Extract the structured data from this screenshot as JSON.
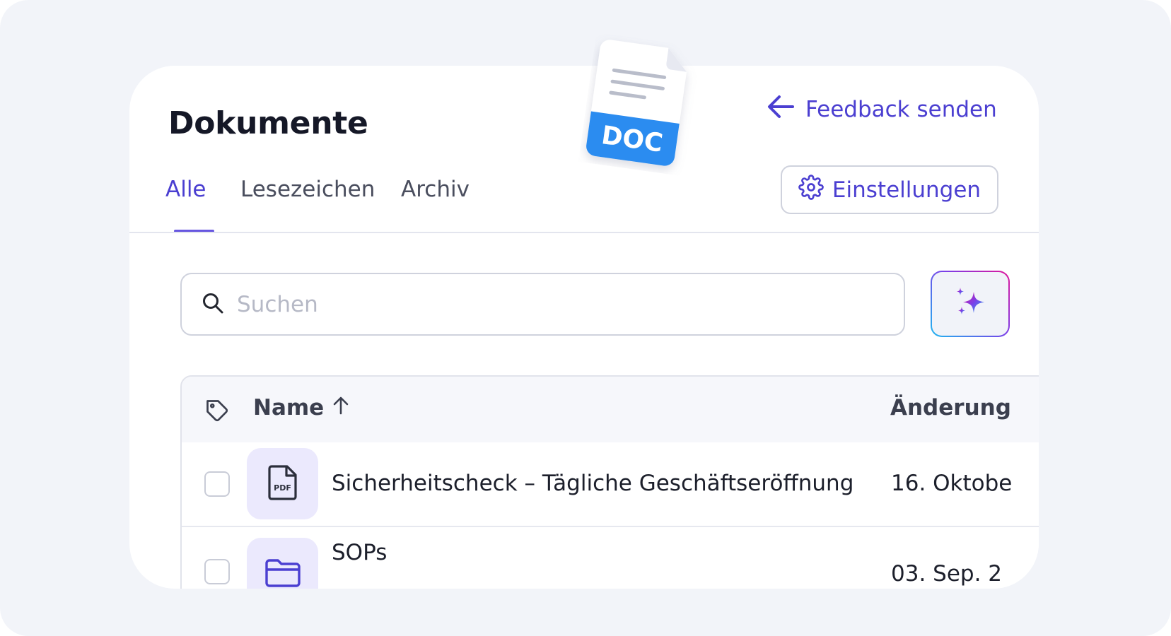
{
  "page": {
    "title": "Dokumente",
    "feedback_label": "Feedback senden",
    "settings_label": "Einstellungen"
  },
  "tabs": [
    {
      "label": "Alle",
      "active": true
    },
    {
      "label": "Lesezeichen",
      "active": false
    },
    {
      "label": "Archiv",
      "active": false
    }
  ],
  "search": {
    "placeholder": "Suchen",
    "value": ""
  },
  "floating_badge": {
    "label": "DOC"
  },
  "table": {
    "columns": {
      "name": "Name",
      "date": "Änderung"
    },
    "sort": {
      "column": "Name",
      "direction": "ascending"
    },
    "rows": [
      {
        "name": "Sicherheitscheck – Tägliche Geschäftseröffnung",
        "date": "16. Oktobe",
        "type": "pdf",
        "icon_label": "PDF",
        "icon": "pdf-file-icon"
      },
      {
        "name": "SOPs",
        "date": "03. Sep. 2",
        "type": "folder",
        "icon": "folder-icon"
      }
    ]
  },
  "colors": {
    "accent": "#4b3fd1",
    "tab_underline": "#6656e0",
    "background": "#f2f4f9",
    "tile": "#ebe9fd",
    "doc_badge": "#2b8cf0"
  },
  "icons": {
    "back": "arrow-left-icon",
    "settings": "gear-icon",
    "search": "search-icon",
    "ai": "sparkles-icon",
    "tag": "tag-icon",
    "sort": "arrow-up-icon"
  }
}
